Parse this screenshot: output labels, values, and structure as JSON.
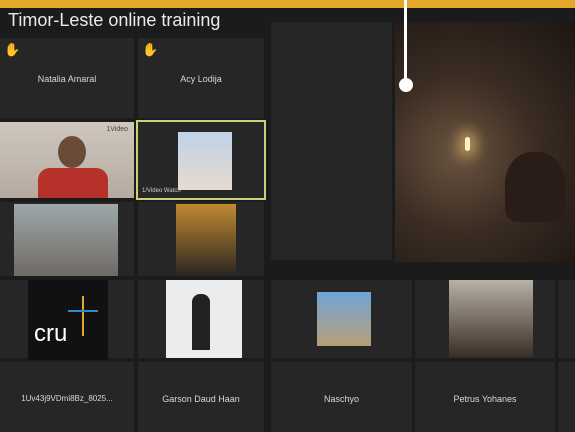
{
  "meeting": {
    "title": "Timor-Leste online training"
  },
  "participants": [
    {
      "name": "Natalia Amaral",
      "raised_hand": true
    },
    {
      "name": "Acy Lodija",
      "raised_hand": true
    },
    {
      "name": "1Uv43j9VDmi8Bz_8025...",
      "raised_hand": false
    },
    {
      "name": "Garson Daud Haan",
      "raised_hand": false
    },
    {
      "name": "Naschyo",
      "raised_hand": false
    },
    {
      "name": "Petrus Yohanes",
      "raised_hand": false
    }
  ],
  "tile_badges": {
    "top_left_video": "1Video",
    "highlight_video": "1/Video Watch"
  },
  "logo_text": "cru",
  "colors": {
    "accent": "#e3a72a",
    "highlight": "#c9d27a",
    "tile_bg": "#262626"
  }
}
